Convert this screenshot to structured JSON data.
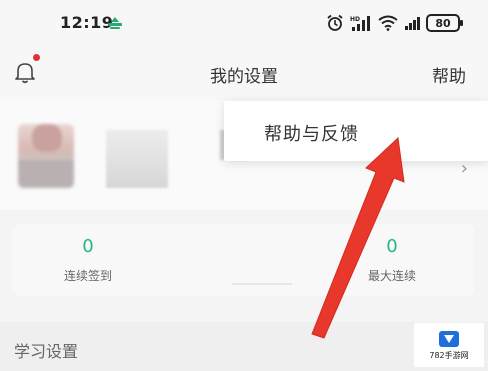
{
  "status_bar": {
    "time": "12:19",
    "battery": "80",
    "network_badge": "HD"
  },
  "header": {
    "title": "我的设置",
    "help_label": "帮助"
  },
  "popup": {
    "item_label": "帮助与反馈"
  },
  "stats": [
    {
      "value": "0",
      "label": "连续签到"
    },
    {
      "value": "0",
      "label": "最大连续"
    }
  ],
  "section": {
    "title": "学习设置"
  },
  "watermark": {
    "text": "782手游网"
  },
  "colors": {
    "accent_green": "#2bb38a",
    "arrow_red": "#e8382b",
    "notification_dot": "#e2303a"
  }
}
